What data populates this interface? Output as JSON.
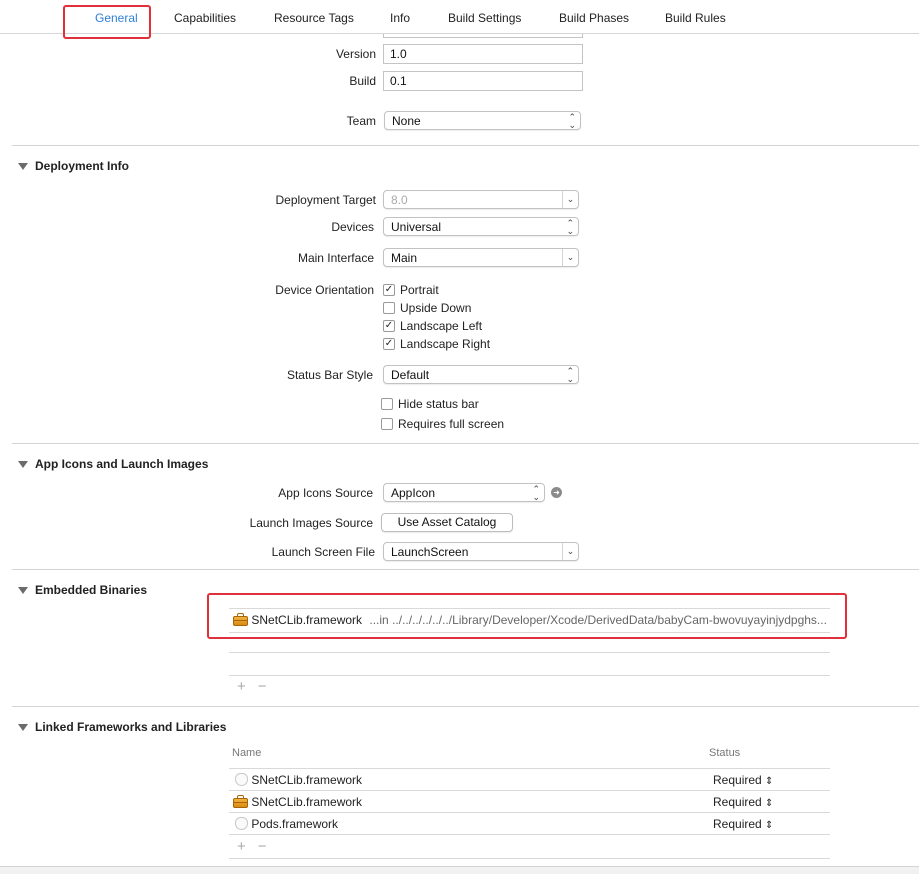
{
  "tabs": [
    "General",
    "Capabilities",
    "Resource Tags",
    "Info",
    "Build Settings",
    "Build Phases",
    "Build Rules"
  ],
  "identity": {
    "version_label": "Version",
    "version_value": "1.0",
    "build_label": "Build",
    "build_value": "0.1",
    "team_label": "Team",
    "team_value": "None"
  },
  "deployment": {
    "title": "Deployment Info",
    "target_label": "Deployment Target",
    "target_value": "8.0",
    "devices_label": "Devices",
    "devices_value": "Universal",
    "main_interface_label": "Main Interface",
    "main_interface_value": "Main",
    "orientation_label": "Device Orientation",
    "orientations": [
      {
        "label": "Portrait",
        "checked": true
      },
      {
        "label": "Upside Down",
        "checked": false
      },
      {
        "label": "Landscape Left",
        "checked": true
      },
      {
        "label": "Landscape Right",
        "checked": true
      }
    ],
    "status_bar_label": "Status Bar Style",
    "status_bar_value": "Default",
    "hide_status_bar": {
      "label": "Hide status bar",
      "checked": false
    },
    "requires_full_screen": {
      "label": "Requires full screen",
      "checked": false
    }
  },
  "app_icons": {
    "title": "App Icons and Launch Images",
    "icons_source_label": "App Icons Source",
    "icons_source_value": "AppIcon",
    "launch_images_label": "Launch Images Source",
    "launch_images_button": "Use Asset Catalog",
    "launch_screen_label": "Launch Screen File",
    "launch_screen_value": "LaunchScreen"
  },
  "embedded": {
    "title": "Embedded Binaries",
    "rows": [
      {
        "name": "SNetCLib.framework",
        "path": "...in ../../../../../../Library/Developer/Xcode/DerivedData/babyCam-bwovuyayinjydpghs...",
        "icon": "framework-icon"
      }
    ],
    "add_symbol": "+",
    "remove_symbol": "−"
  },
  "linked": {
    "title": "Linked Frameworks and Libraries",
    "columns": {
      "name": "Name",
      "status": "Status"
    },
    "rows": [
      {
        "name": "SNetCLib.framework",
        "status": "Required",
        "icon": "shield-icon"
      },
      {
        "name": "SNetCLib.framework",
        "status": "Required",
        "icon": "framework-icon"
      },
      {
        "name": "Pods.framework",
        "status": "Required",
        "icon": "shield-icon"
      }
    ],
    "add_symbol": "+",
    "remove_symbol": "−"
  },
  "colors": {
    "accent": "#2f7fd8",
    "highlight_box": "#e0303a"
  }
}
